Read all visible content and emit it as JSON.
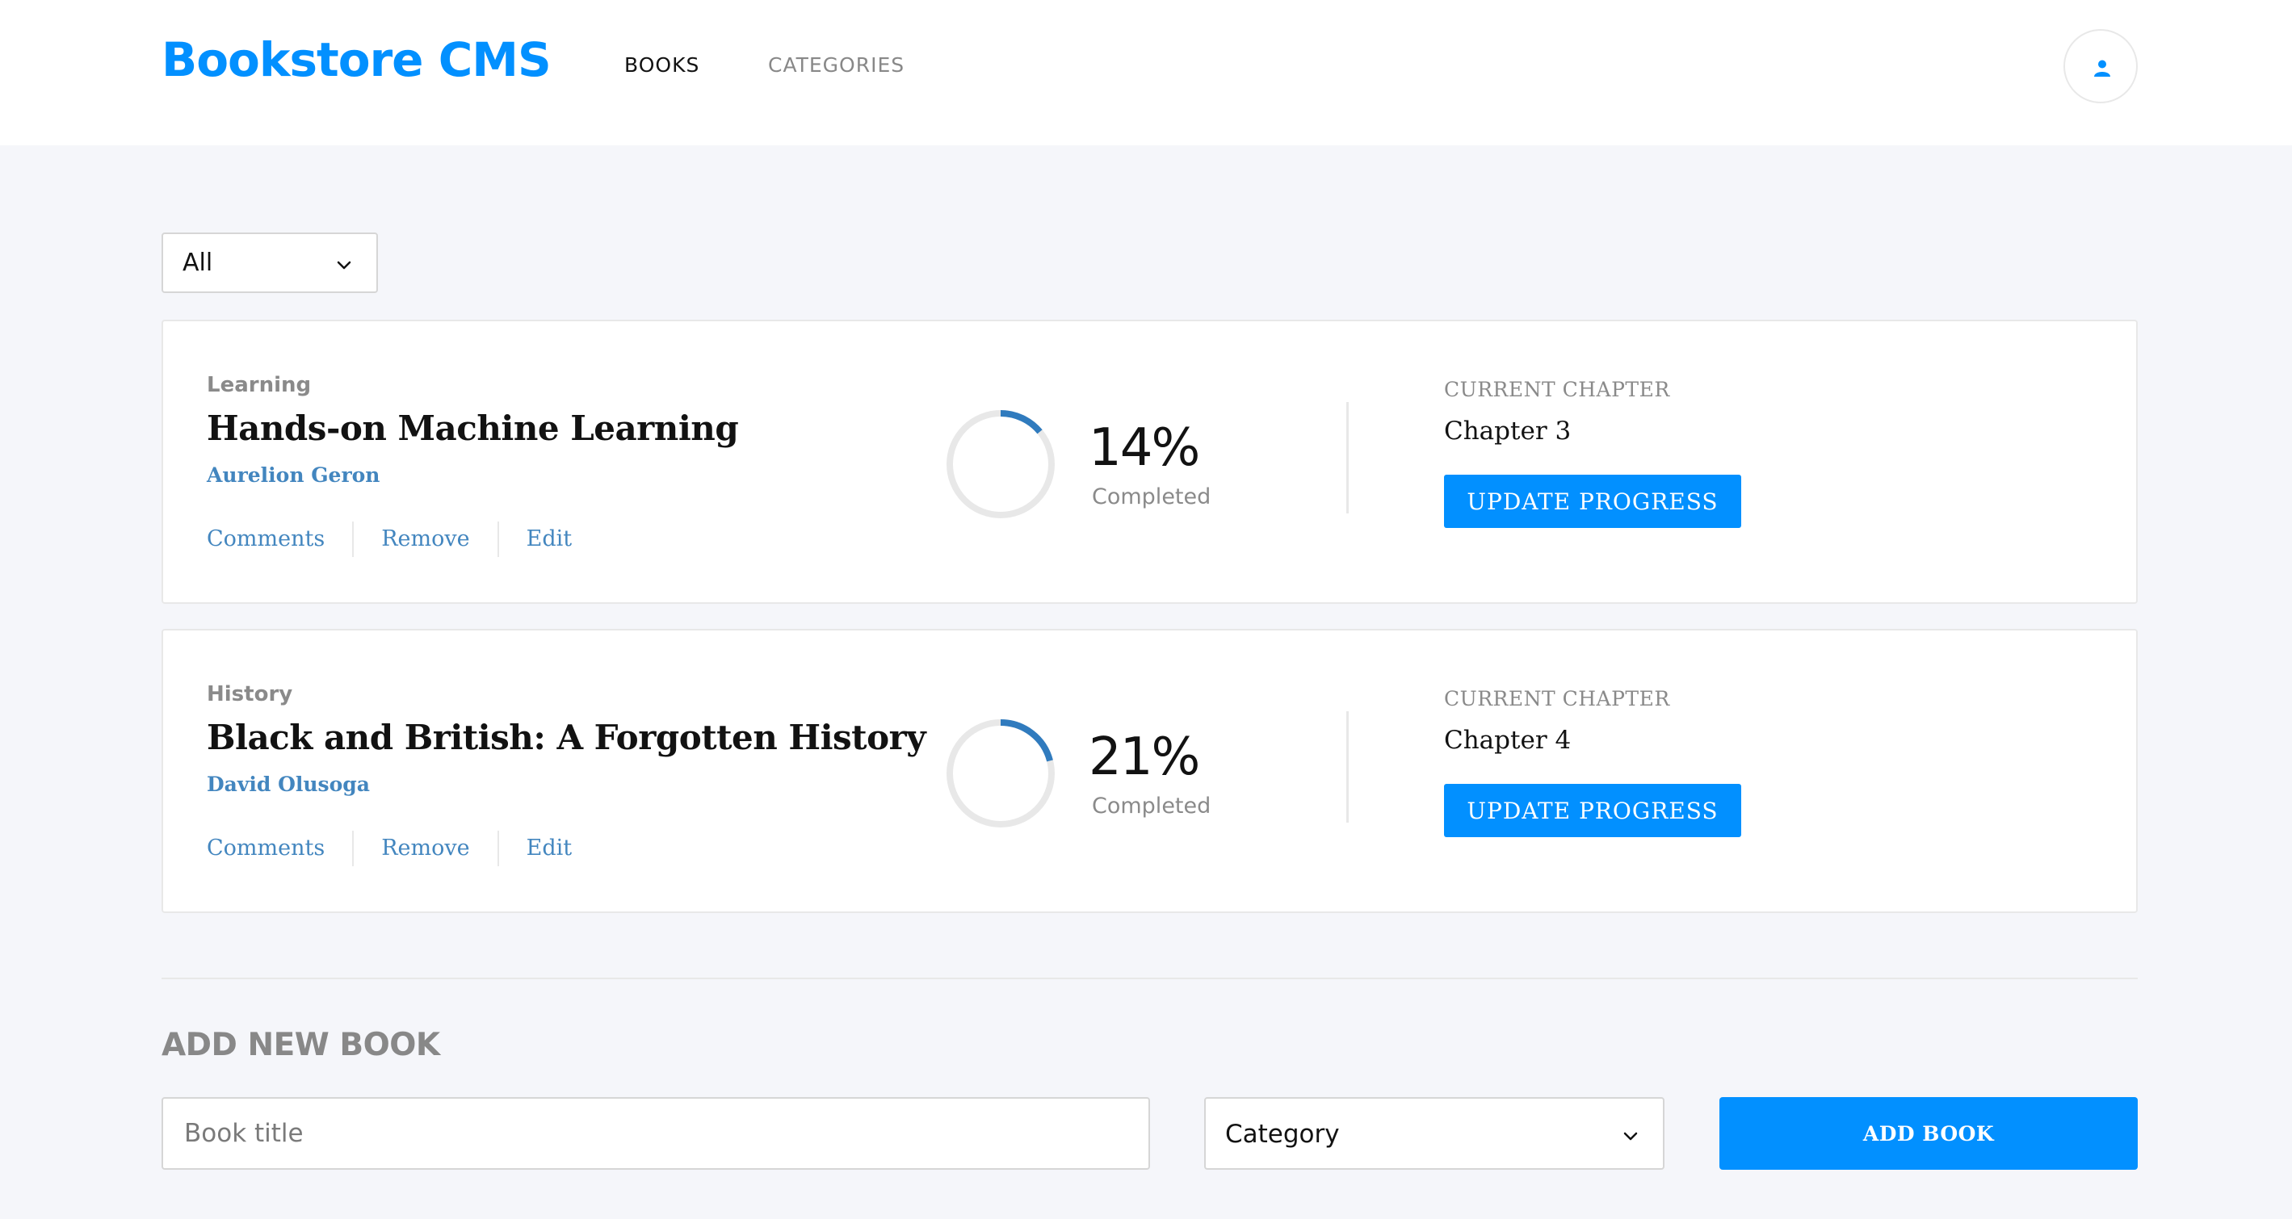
{
  "header": {
    "logo": "Bookstore CMS",
    "nav": {
      "books": "BOOKS",
      "categories": "CATEGORIES"
    },
    "avatar_icon": "user-icon"
  },
  "filter": {
    "selected": "All"
  },
  "books": [
    {
      "category": "Learning",
      "title": "Hands-on Machine Learning",
      "author": "Aurelion Geron",
      "actions": {
        "comments": "Comments",
        "remove": "Remove",
        "edit": "Edit"
      },
      "progress_percent": 14,
      "percent_label": "14%",
      "completed_label": "Completed",
      "chapter_label": "CURRENT CHAPTER",
      "chapter": "Chapter 3",
      "update_label": "UPDATE PROGRESS"
    },
    {
      "category": "History",
      "title": "Black and British: A Forgotten History",
      "author": "David Olusoga",
      "actions": {
        "comments": "Comments",
        "remove": "Remove",
        "edit": "Edit"
      },
      "progress_percent": 21,
      "percent_label": "21%",
      "completed_label": "Completed",
      "chapter_label": "CURRENT CHAPTER",
      "chapter": "Chapter 4",
      "update_label": "UPDATE PROGRESS"
    }
  ],
  "form": {
    "title": "ADD NEW BOOK",
    "title_placeholder": "Book title",
    "category_placeholder": "Category",
    "submit_label": "ADD BOOK"
  },
  "colors": {
    "accent": "#0290ff",
    "link": "#4386bf",
    "progress": "#307bbe",
    "track": "#e8e8e8",
    "background": "#f5f6fa"
  }
}
